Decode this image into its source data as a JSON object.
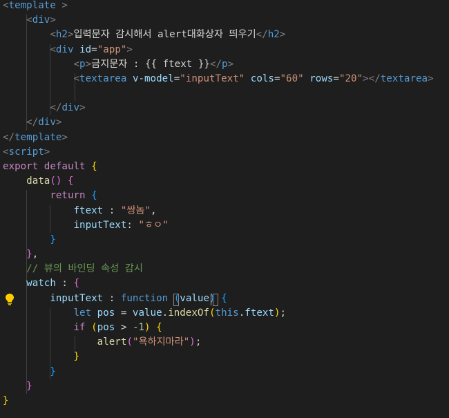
{
  "editor": {
    "language_hint": "vue",
    "code": [
      {
        "tokens": [
          {
            "t": "<",
            "c": "br"
          },
          {
            "t": "template",
            "c": "tag"
          },
          {
            "t": " >",
            "c": "br"
          }
        ]
      },
      {
        "tokens": [
          {
            "t": "    "
          },
          {
            "t": "<",
            "c": "br"
          },
          {
            "t": "div",
            "c": "tag"
          },
          {
            "t": ">",
            "c": "br"
          }
        ]
      },
      {
        "tokens": [
          {
            "t": "        "
          },
          {
            "t": "<",
            "c": "br"
          },
          {
            "t": "h2",
            "c": "tag"
          },
          {
            "t": ">",
            "c": "br"
          },
          {
            "t": "입력문자 감시해서 alert대화상자 띄우기",
            "c": "text"
          },
          {
            "t": "</",
            "c": "br"
          },
          {
            "t": "h2",
            "c": "tag"
          },
          {
            "t": ">",
            "c": "br"
          }
        ]
      },
      {
        "tokens": [
          {
            "t": "        "
          },
          {
            "t": "<",
            "c": "br"
          },
          {
            "t": "div",
            "c": "tag"
          },
          {
            "t": " "
          },
          {
            "t": "id",
            "c": "attr"
          },
          {
            "t": "=",
            "c": "text"
          },
          {
            "t": "\"app\"",
            "c": "str"
          },
          {
            "t": ">",
            "c": "br"
          }
        ]
      },
      {
        "tokens": [
          {
            "t": "            "
          },
          {
            "t": "<",
            "c": "br"
          },
          {
            "t": "p",
            "c": "tag"
          },
          {
            "t": ">",
            "c": "br"
          },
          {
            "t": "금지문자 : {{ ftext }}",
            "c": "text"
          },
          {
            "t": "</",
            "c": "br"
          },
          {
            "t": "p",
            "c": "tag"
          },
          {
            "t": ">",
            "c": "br"
          }
        ]
      },
      {
        "tokens": [
          {
            "t": "            "
          },
          {
            "t": "<",
            "c": "br"
          },
          {
            "t": "textarea",
            "c": "tag"
          },
          {
            "t": " "
          },
          {
            "t": "v-model",
            "c": "attr"
          },
          {
            "t": "=",
            "c": "text"
          },
          {
            "t": "\"inputText\"",
            "c": "str"
          },
          {
            "t": " "
          },
          {
            "t": "cols",
            "c": "attr"
          },
          {
            "t": "=",
            "c": "text"
          },
          {
            "t": "\"60\"",
            "c": "str"
          },
          {
            "t": " "
          },
          {
            "t": "rows",
            "c": "attr"
          },
          {
            "t": "=",
            "c": "text"
          },
          {
            "t": "\"20\"",
            "c": "str"
          },
          {
            "t": "></",
            "c": "br"
          },
          {
            "t": "textarea",
            "c": "tag"
          },
          {
            "t": ">",
            "c": "br"
          }
        ]
      },
      {
        "tokens": [
          {
            "t": ""
          }
        ]
      },
      {
        "tokens": [
          {
            "t": "        "
          },
          {
            "t": "</",
            "c": "br"
          },
          {
            "t": "div",
            "c": "tag"
          },
          {
            "t": ">",
            "c": "br"
          }
        ]
      },
      {
        "tokens": [
          {
            "t": "    "
          },
          {
            "t": "</",
            "c": "br"
          },
          {
            "t": "div",
            "c": "tag"
          },
          {
            "t": ">",
            "c": "br"
          }
        ]
      },
      {
        "tokens": [
          {
            "t": "</",
            "c": "br"
          },
          {
            "t": "template",
            "c": "tag"
          },
          {
            "t": ">",
            "c": "br"
          }
        ]
      },
      {
        "tokens": [
          {
            "t": "<",
            "c": "br"
          },
          {
            "t": "script",
            "c": "tag"
          },
          {
            "t": ">",
            "c": "br"
          }
        ]
      },
      {
        "tokens": [
          {
            "t": "export",
            "c": "kw"
          },
          {
            "t": " "
          },
          {
            "t": "default",
            "c": "kw"
          },
          {
            "t": " "
          },
          {
            "t": "{",
            "c": "b1"
          }
        ]
      },
      {
        "tokens": [
          {
            "t": "    "
          },
          {
            "t": "data",
            "c": "fn"
          },
          {
            "t": "()",
            "c": "b2"
          },
          {
            "t": " "
          },
          {
            "t": "{",
            "c": "b2"
          }
        ]
      },
      {
        "tokens": [
          {
            "t": "        "
          },
          {
            "t": "return",
            "c": "kw"
          },
          {
            "t": " "
          },
          {
            "t": "{",
            "c": "b3"
          }
        ]
      },
      {
        "tokens": [
          {
            "t": "            "
          },
          {
            "t": "ftext",
            "c": "var"
          },
          {
            "t": " : "
          },
          {
            "t": "\"쌍놈\"",
            "c": "str"
          },
          {
            "t": ","
          }
        ]
      },
      {
        "tokens": [
          {
            "t": "            "
          },
          {
            "t": "inputText",
            "c": "var"
          },
          {
            "t": ": "
          },
          {
            "t": "\"ㅎㅇ\"",
            "c": "str"
          }
        ]
      },
      {
        "tokens": [
          {
            "t": "        "
          },
          {
            "t": "}",
            "c": "b3"
          }
        ]
      },
      {
        "tokens": [
          {
            "t": "    "
          },
          {
            "t": "}",
            "c": "b2"
          },
          {
            "t": ","
          }
        ]
      },
      {
        "tokens": [
          {
            "t": "    "
          },
          {
            "t": "// 뷰의 바인딩 속성 감시",
            "c": "com"
          }
        ]
      },
      {
        "tokens": [
          {
            "t": "    "
          },
          {
            "t": "watch",
            "c": "var"
          },
          {
            "t": " : "
          },
          {
            "t": "{",
            "c": "b2"
          }
        ]
      },
      {
        "tokens": [
          {
            "t": "        "
          },
          {
            "t": "inputText",
            "c": "var"
          },
          {
            "t": " : "
          },
          {
            "t": "function",
            "c": "kw2"
          },
          {
            "t": " "
          },
          {
            "t": "(",
            "c": "b3"
          },
          {
            "t": "value",
            "c": "var"
          },
          {
            "t": ")",
            "c": "b3"
          },
          {
            "t": " "
          },
          {
            "t": "{",
            "c": "b3"
          }
        ]
      },
      {
        "tokens": [
          {
            "t": "            "
          },
          {
            "t": "let",
            "c": "kw2"
          },
          {
            "t": " "
          },
          {
            "t": "pos",
            "c": "var"
          },
          {
            "t": " = "
          },
          {
            "t": "value",
            "c": "var"
          },
          {
            "t": "."
          },
          {
            "t": "indexOf",
            "c": "fn"
          },
          {
            "t": "(",
            "c": "b1"
          },
          {
            "t": "this",
            "c": "kw2"
          },
          {
            "t": "."
          },
          {
            "t": "ftext",
            "c": "var"
          },
          {
            "t": ")",
            "c": "b1"
          },
          {
            "t": ";"
          }
        ]
      },
      {
        "tokens": [
          {
            "t": "            "
          },
          {
            "t": "if",
            "c": "kw"
          },
          {
            "t": " "
          },
          {
            "t": "(",
            "c": "b1"
          },
          {
            "t": "pos",
            "c": "var"
          },
          {
            "t": " > "
          },
          {
            "t": "-1",
            "c": "num"
          },
          {
            "t": ")",
            "c": "b1"
          },
          {
            "t": " "
          },
          {
            "t": "{",
            "c": "b1"
          }
        ]
      },
      {
        "tokens": [
          {
            "t": "                "
          },
          {
            "t": "alert",
            "c": "fn"
          },
          {
            "t": "(",
            "c": "b2"
          },
          {
            "t": "\"욕하지마라\"",
            "c": "str"
          },
          {
            "t": ")",
            "c": "b2"
          },
          {
            "t": ";"
          }
        ]
      },
      {
        "tokens": [
          {
            "t": "            "
          },
          {
            "t": "}",
            "c": "b1"
          }
        ]
      },
      {
        "tokens": [
          {
            "t": "        "
          },
          {
            "t": "}",
            "c": "b3"
          }
        ]
      },
      {
        "tokens": [
          {
            "t": "    "
          },
          {
            "t": "}",
            "c": "b2"
          }
        ]
      },
      {
        "tokens": [
          {
            "t": "}",
            "c": "b1"
          }
        ]
      }
    ]
  },
  "lightbulb": {
    "icon": "lightbulb-icon",
    "color": "#ffcc00"
  }
}
